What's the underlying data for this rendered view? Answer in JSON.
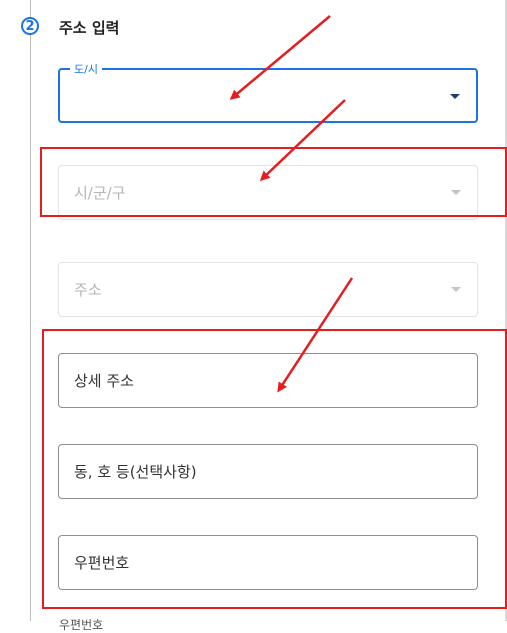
{
  "step": {
    "number": "2",
    "title": "주소 입력"
  },
  "fields": {
    "province": {
      "label": "도/시",
      "value": ""
    },
    "city": {
      "placeholder": "시/군/구"
    },
    "address": {
      "placeholder": "주소"
    },
    "detail_address": {
      "placeholder": "상세 주소"
    },
    "unit": {
      "placeholder": "동, 호 등(선택사항)"
    },
    "postal_code": {
      "placeholder": "우편번호"
    }
  },
  "footer_partial_text": "우편번호",
  "colors": {
    "accent": "#1a73e8",
    "annotation": "#e41e1e",
    "disabled_border": "#e3e3e3",
    "normal_border": "#8e8e8e"
  },
  "icons": [
    "chevron-down-icon"
  ]
}
